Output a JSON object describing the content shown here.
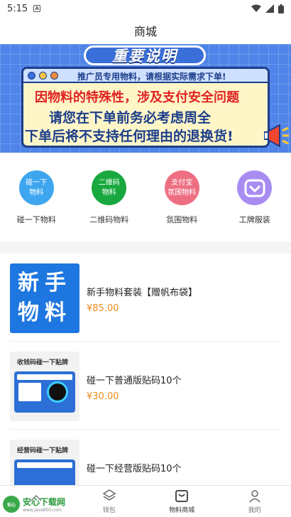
{
  "status_bar": {
    "time": "5:15",
    "notif_letter": "A"
  },
  "header": {
    "title": "商城"
  },
  "banner": {
    "title": "重要说明",
    "subtitle": "推广员专用物料，请根据实际需求下单!",
    "line1": "因物料的特殊性，涉及支付安全问题",
    "line2": "请您在下单前务必考虑周全",
    "line3": "下单后将不支持任何理由的退换货!"
  },
  "quick_nav": [
    {
      "circle_text_1": "碰一下",
      "circle_text_2": "物料",
      "label": "碰一下物料",
      "color": "#3ea6ef"
    },
    {
      "circle_text_1": "二维码",
      "circle_text_2": "物料",
      "label": "二维码物料",
      "color": "#19a83f"
    },
    {
      "circle_text_1": "支付宝",
      "circle_text_2": "氛围物料",
      "label": "氛围物料",
      "color": "#ee6f82"
    },
    {
      "circle_text_1": "",
      "circle_text_2": "",
      "label": "工牌服装",
      "color": "#a98cf2"
    }
  ],
  "products": [
    {
      "name": "新手物料套装【赠帆布袋】",
      "price": "¥85.00",
      "thumb_line1": "新手",
      "thumb_line2": "物料"
    },
    {
      "name": "碰一下普通版贴码10个",
      "price": "¥30.00",
      "thumb_caption": "收钱码碰一下贴牌"
    },
    {
      "name": "碰一下经营版贴码10个",
      "price": "",
      "thumb_caption": "经营码碰一下贴牌"
    }
  ],
  "tabs": [
    {
      "label": "",
      "icon": "home-icon"
    },
    {
      "label": "钱包",
      "icon": "layers-icon"
    },
    {
      "label": "物料商城",
      "icon": "store-icon"
    },
    {
      "label": "我的",
      "icon": "user-icon"
    }
  ],
  "watermark": {
    "logo_text": "安心",
    "main": "安心下载网",
    "sub": "www.java800.com"
  },
  "colors": {
    "accent": "#ee8c1a",
    "banner_blue": "#4f84e8"
  }
}
